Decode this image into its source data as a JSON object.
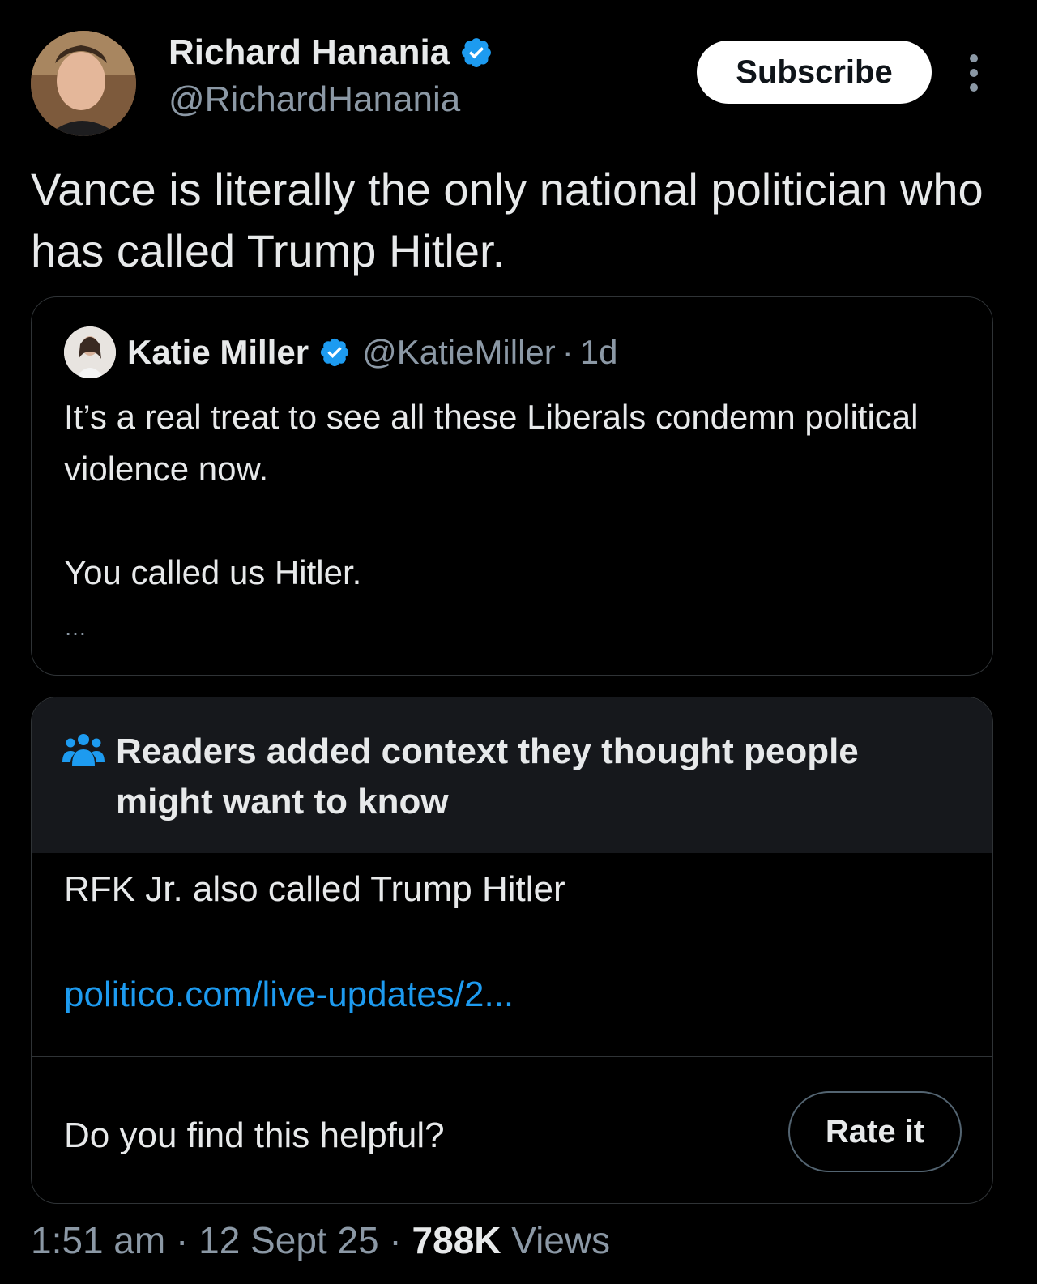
{
  "author": {
    "display_name": "Richard Hanania",
    "handle": "@RichardHanania",
    "verified": true
  },
  "subscribe_label": "Subscribe",
  "tweet_text": "Vance is literally the only national politician who has called Trump Hitler.",
  "quote": {
    "display_name": "Katie Miller",
    "handle": "@KatieMiller",
    "separator": "·",
    "time": "1d",
    "text_line1": "It’s a real treat to see all these Liberals condemn political violence now.",
    "text_line2": "You called us Hitler.",
    "truncation": "…"
  },
  "community_note": {
    "title": "Readers added context they thought people might want to know",
    "body": "RFK Jr. also called Trump Hitler",
    "link_text": "politico.com/live-updates/2...",
    "helpful_prompt": "Do you find this helpful?",
    "rate_label": "Rate it"
  },
  "meta": {
    "time": "1:51 am",
    "sep1": " · ",
    "date": "12 Sept 25",
    "sep2": " · ",
    "views_count": "788K",
    "views_label": " Views"
  },
  "colors": {
    "background": "#000000",
    "text_primary": "#e7e9ea",
    "text_secondary": "#8b98a5",
    "accent_blue": "#1d9bf0",
    "note_header_bg": "#16181c",
    "border": "#2f3336"
  },
  "icons": [
    "verified-badge-icon",
    "more-options-icon",
    "community-notes-icon"
  ]
}
